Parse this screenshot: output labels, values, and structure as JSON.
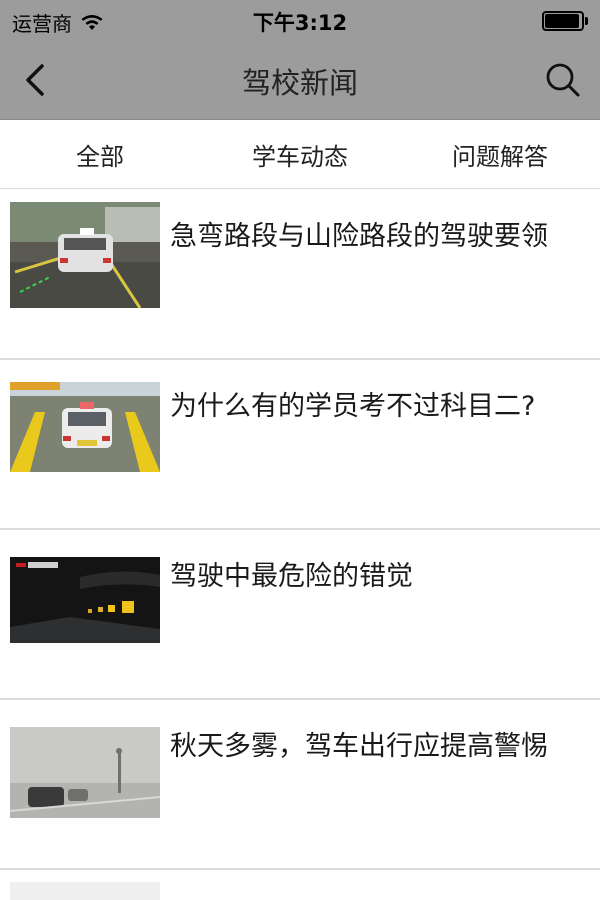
{
  "status_bar": {
    "carrier": "运营商",
    "time": "下午3:12",
    "battery_level": 0.95
  },
  "nav": {
    "title": "驾校新闻",
    "back_icon": "chevron-left-icon",
    "search_icon": "search-icon"
  },
  "tabs": [
    {
      "label": "全部"
    },
    {
      "label": "学车动态"
    },
    {
      "label": "问题解答"
    }
  ],
  "news": [
    {
      "title": "急弯路段与山险路段的驾驶要领",
      "thumb": "driving-test-car-photo"
    },
    {
      "title": "为什么有的学员考不过科目二?",
      "thumb": "test-course-car-photo"
    },
    {
      "title": "驾驶中最危险的错觉",
      "thumb": "night-road-sign-photo"
    },
    {
      "title": "秋天多雾，驾车出行应提高警惕",
      "thumb": "foggy-road-photo"
    }
  ],
  "colors": {
    "header_bg": "#9c9c9c",
    "divider": "#dcdcdc",
    "text": "#1a1a1a"
  }
}
